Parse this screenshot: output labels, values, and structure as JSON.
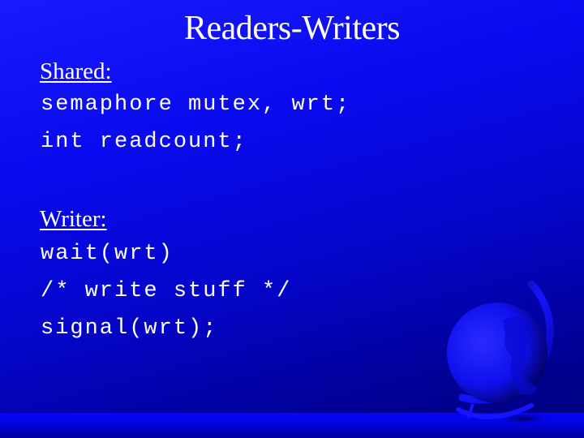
{
  "slide": {
    "title": "Readers-Writers",
    "sections": [
      {
        "label": "Shared:",
        "code_lines": [
          "semaphore mutex, wrt;",
          "int readcount;"
        ]
      },
      {
        "label": "Writer:",
        "code_lines": [
          "wait(wrt)",
          "/* write stuff */",
          "signal(wrt);"
        ]
      }
    ],
    "decoration": "globe-icon",
    "colors": {
      "title": "#ffffe0",
      "text": "#ffffff",
      "background_top": "#1a1aff",
      "background_bottom": "#000080"
    }
  }
}
